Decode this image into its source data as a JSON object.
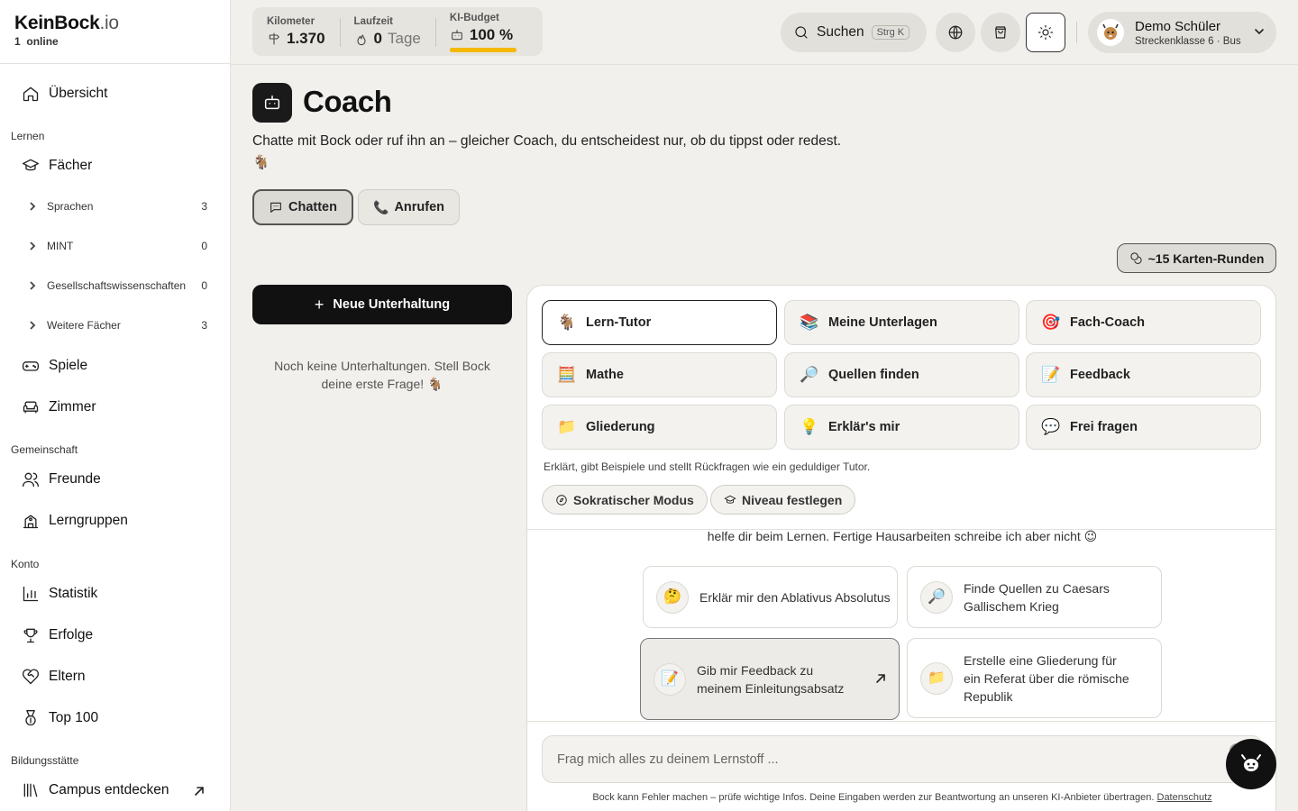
{
  "brand": {
    "name": "KeinBock",
    "tld": ".io",
    "online_count": "1",
    "online_label": "online"
  },
  "sidebar": {
    "overview": "Übersicht",
    "section_learn": "Lernen",
    "subjects": "Fächer",
    "sub_items": [
      {
        "label": "Sprachen",
        "count": "3"
      },
      {
        "label": "MINT",
        "count": "0"
      },
      {
        "label": "Gesellschaftswissenschaften",
        "count": "0"
      },
      {
        "label": "Weitere Fächer",
        "count": "3"
      }
    ],
    "games": "Spiele",
    "room": "Zimmer",
    "section_community": "Gemeinschaft",
    "friends": "Freunde",
    "study_groups": "Lerngruppen",
    "section_account": "Konto",
    "statistics": "Statistik",
    "achievements": "Erfolge",
    "parents": "Eltern",
    "top100": "Top 100",
    "section_school": "Bildungsstätte",
    "campus": "Campus entdecken"
  },
  "topbar": {
    "km_label": "Kilometer",
    "km_value": "1.370",
    "runtime_label": "Laufzeit",
    "runtime_value": "0",
    "runtime_unit": "Tage",
    "budget_label": "KI-Budget",
    "budget_value": "100 %",
    "budget_fraction": 1.0,
    "search_label": "Suchen",
    "search_shortcut": "Strg K",
    "user_name": "Demo Schüler",
    "user_sub": "Streckenklasse 6 · Bus"
  },
  "main": {
    "title": "Coach",
    "description": "Chatte mit Bock oder ruf ihn an – gleicher Coach, du entscheidest nur, ob du tippst oder redest.",
    "tab_chat": "Chatten",
    "tab_call": "Anrufen",
    "card_rounds": "~15 Karten-Runden",
    "new_conversation": "Neue Unterhaltung",
    "empty_note": "Noch keine Unterhaltungen. Stell Bock deine erste Frage! 🐐"
  },
  "chat": {
    "modes": [
      {
        "label": "Lern-Tutor",
        "emoji": "🐐"
      },
      {
        "label": "Meine Unterlagen",
        "emoji": "📚"
      },
      {
        "label": "Fach-Coach",
        "emoji": "🎯"
      },
      {
        "label": "Mathe",
        "emoji": "🧮"
      },
      {
        "label": "Quellen finden",
        "emoji": "🔎"
      },
      {
        "label": "Feedback",
        "emoji": "📝"
      },
      {
        "label": "Gliederung",
        "emoji": "📁"
      },
      {
        "label": "Erklär's mir",
        "emoji": "💡"
      },
      {
        "label": "Frei fragen",
        "emoji": "💬"
      }
    ],
    "mode_description": "Erklärt, gibt Beispiele und stellt Rückfragen wie ein geduldiger Tutor.",
    "chip_socratic": "Sokratischer Modus",
    "chip_level": "Niveau festlegen",
    "greeting_tail": "helfe dir beim Lernen. Fertige Hausarbeiten schreibe ich aber nicht 😉",
    "suggestions": [
      {
        "text": "Erklär mir den Ablativus Absolutus",
        "emoji": "🤔"
      },
      {
        "text": "Finde Quellen zu Caesars Gallischem Krieg",
        "emoji": "🔎"
      },
      {
        "text": "Gib mir Feedback zu meinem Einleitungsabsatz",
        "emoji": "📝"
      },
      {
        "text": "Erstelle eine Gliederung für ein Referat über die römische Republik",
        "emoji": "📁"
      }
    ],
    "input_placeholder": "Frag mich alles zu deinem Lernstoff ...",
    "disclaimer": "Bock kann Fehler machen – prüfe wichtige Infos. Deine Eingaben werden zur Beantwortung an unseren KI-Anbieter übertragen.",
    "privacy_link": "Datenschutz"
  }
}
